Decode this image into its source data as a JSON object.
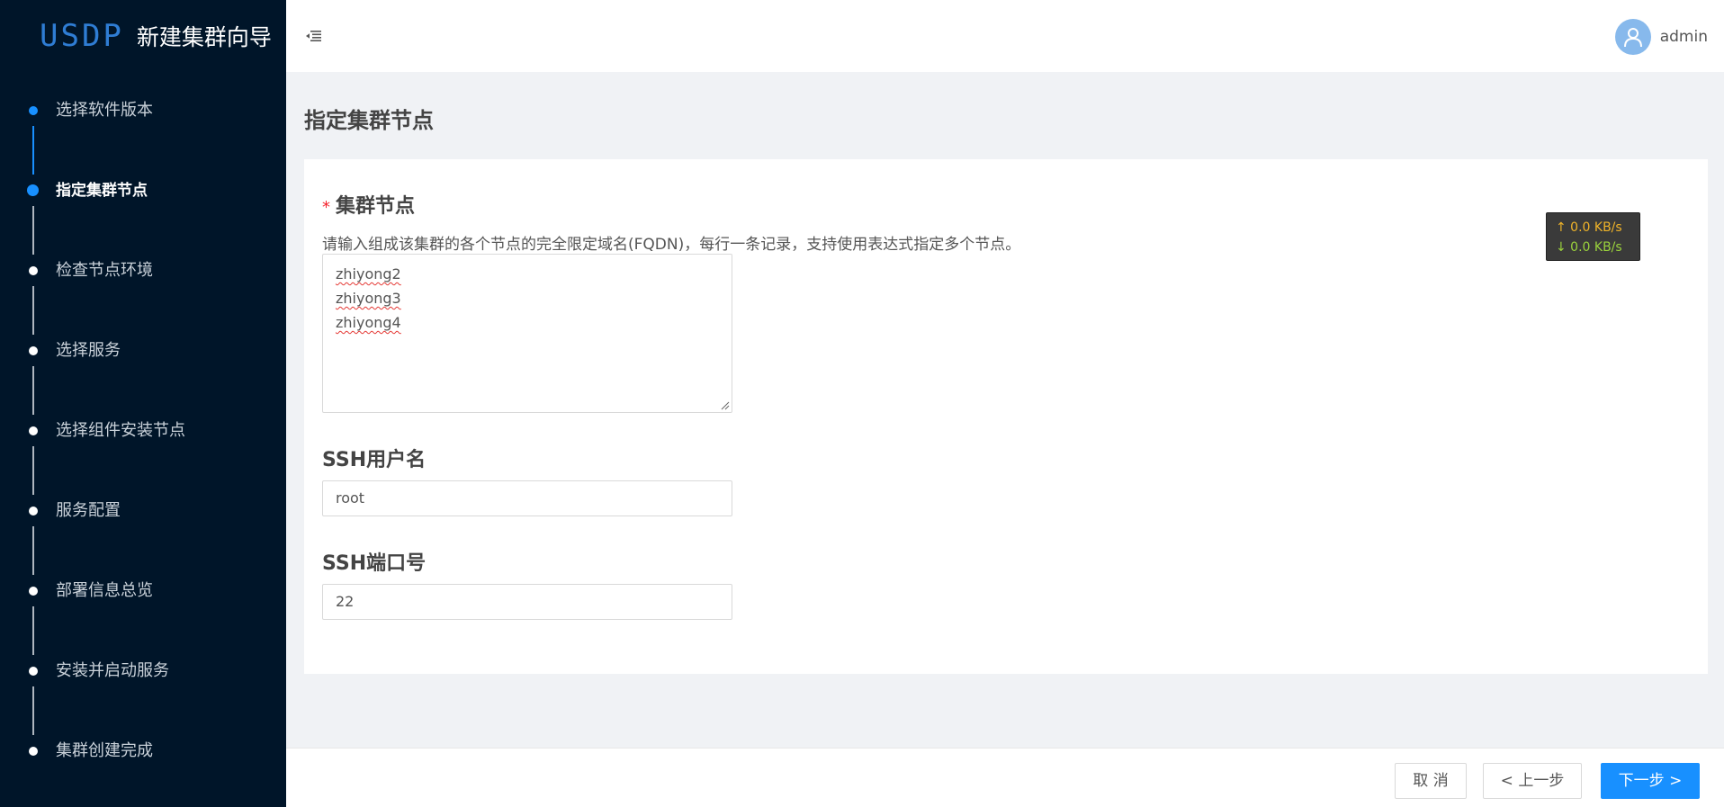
{
  "brand": {
    "logo": "USDP",
    "title": "新建集群向导"
  },
  "steps": [
    {
      "label": "选择软件版本",
      "status": "done"
    },
    {
      "label": "指定集群节点",
      "status": "active"
    },
    {
      "label": "检查节点环境",
      "status": "pending"
    },
    {
      "label": "选择服务",
      "status": "pending"
    },
    {
      "label": "选择组件安装节点",
      "status": "pending"
    },
    {
      "label": "服务配置",
      "status": "pending"
    },
    {
      "label": "部署信息总览",
      "status": "pending"
    },
    {
      "label": "安装并启动服务",
      "status": "pending"
    },
    {
      "label": "集群创建完成",
      "status": "pending"
    }
  ],
  "header": {
    "user_name": "admin"
  },
  "page": {
    "title": "指定集群节点",
    "nodes": {
      "required_mark": "*",
      "label": "集群节点",
      "help": "请输入组成该集群的各个节点的完全限定域名(FQDN)，每行一条记录，支持使用表达式指定多个节点。",
      "lines": [
        "zhiyong2",
        "zhiyong3",
        "zhiyong4"
      ]
    },
    "ssh_user": {
      "label": "SSH用户名",
      "value": "root"
    },
    "ssh_port": {
      "label": "SSH端口号",
      "value": "22"
    }
  },
  "netspeed": {
    "up": "↑ 0.0 KB/s",
    "down": "↓ 0.0 KB/s"
  },
  "footer": {
    "cancel": "取 消",
    "prev": "< 上一步",
    "next": "下一步 >"
  },
  "colors": {
    "sidebar_bg": "#001529",
    "primary": "#1890ff",
    "required": "#f5222d"
  }
}
